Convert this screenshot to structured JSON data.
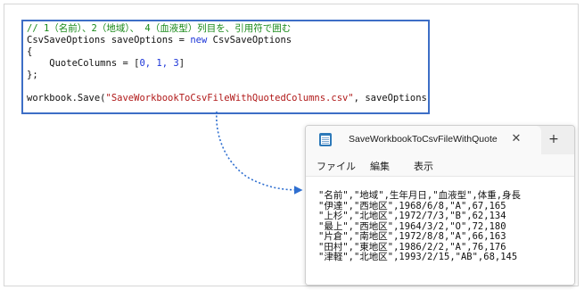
{
  "code": {
    "comment": "// 1（名前）、2（地域）、 4（血液型）列目を、引用符で囲む",
    "line2_a": "CsvSaveOptions saveOptions = ",
    "line2_kw": "new",
    "line2_b": " CsvSaveOptions",
    "line3": "{",
    "line4_a": "    QuoteColumns = [",
    "line4_nums": "0, 1, 3",
    "line4_b": "]",
    "line5": "};",
    "line6": "",
    "line7_a": "workbook.Save(",
    "line7_str": "\"SaveWorkbookToCsvFileWithQuotedColumns.csv\"",
    "line7_b": ", saveOptions);"
  },
  "notepad": {
    "tab_title": "SaveWorkbookToCsvFileWithQuote",
    "close_symbol": "✕",
    "new_tab_symbol": "+",
    "menu": [
      "ファイル",
      "編集",
      "表示"
    ],
    "csv_lines": [
      "\"名前\",\"地域\",生年月日,\"血液型\",体重,身長",
      "\"伊達\",\"西地区\",1968/6/8,\"A\",67,165",
      "\"上杉\",\"北地区\",1972/7/3,\"B\",62,134",
      "\"最上\",\"西地区\",1964/3/2,\"O\",72,180",
      "\"片倉\",\"南地区\",1972/8/8,\"A\",66,163",
      "\"田村\",\"東地区\",1986/2/2,\"A\",76,176",
      "\"津軽\",\"北地区\",1993/2/15,\"AB\",68,145"
    ]
  },
  "colors": {
    "code_border": "#3d6ec6",
    "comment": "#1a8a1a",
    "keyword": "#1c35d8",
    "string": "#b01818",
    "arrow": "#2f6fd0"
  }
}
